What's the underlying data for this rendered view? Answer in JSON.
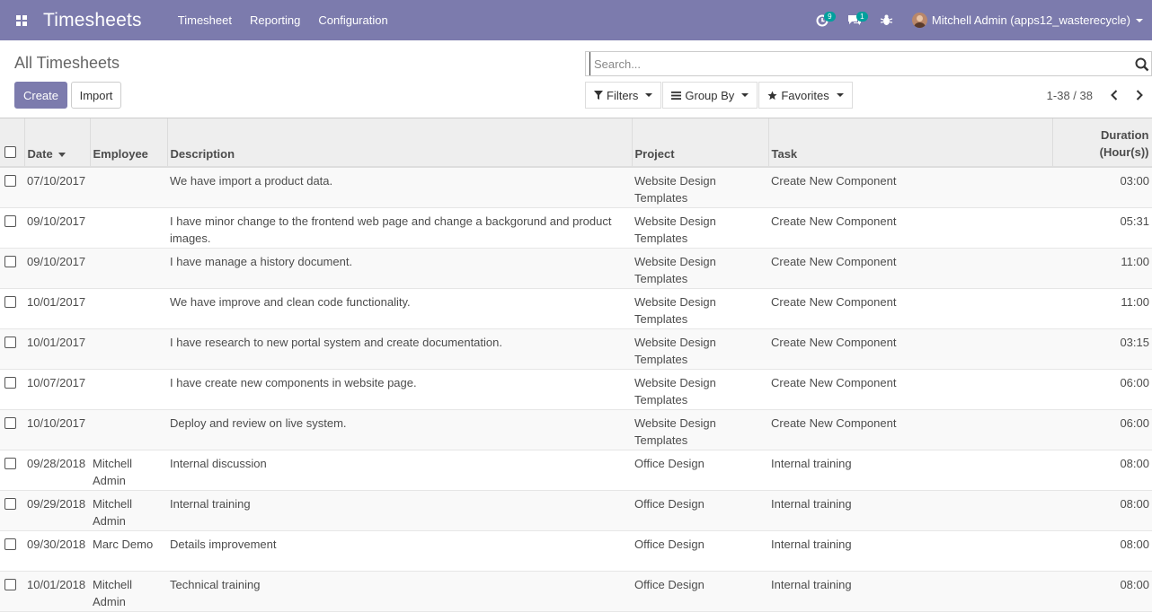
{
  "navbar": {
    "app_title": "Timesheets",
    "menu": [
      {
        "label": "Timesheet"
      },
      {
        "label": "Reporting"
      },
      {
        "label": "Configuration"
      }
    ],
    "activity_count": "9",
    "messages_count": "1",
    "user_name": "Mitchell Admin (apps12_wasterecycle)",
    "bg_color": "#7c7bad",
    "badge_color": "#00a09d"
  },
  "control_panel": {
    "breadcrumb": "All Timesheets",
    "create_label": "Create",
    "import_label": "Import",
    "search_placeholder": "Search...",
    "filters_label": "Filters",
    "groupby_label": "Group By",
    "favorites_label": "Favorites",
    "pager_value": "1-38 / 38"
  },
  "table": {
    "columns": {
      "date": "Date",
      "employee": "Employee",
      "description": "Description",
      "project": "Project",
      "task": "Task",
      "duration_1": "Duration",
      "duration_2": "(Hour(s))"
    },
    "rows": [
      {
        "date": "07/10/2017",
        "employee": "",
        "description": "We have import a product data.",
        "project": "Website Design Templates",
        "task": "Create New Component",
        "duration": "03:00"
      },
      {
        "date": "09/10/2017",
        "employee": "",
        "description": "I have minor change to the frontend web page and change a backgorund and product images.",
        "project": "Website Design Templates",
        "task": "Create New Component",
        "duration": "05:31"
      },
      {
        "date": "09/10/2017",
        "employee": "",
        "description": "I have manage a history document.",
        "project": "Website Design Templates",
        "task": "Create New Component",
        "duration": "11:00"
      },
      {
        "date": "10/01/2017",
        "employee": "",
        "description": "We have improve and clean code functionality.",
        "project": "Website Design Templates",
        "task": "Create New Component",
        "duration": "11:00"
      },
      {
        "date": "10/01/2017",
        "employee": "",
        "description": "I have research to new portal system and create documentation.",
        "project": "Website Design Templates",
        "task": "Create New Component",
        "duration": "03:15"
      },
      {
        "date": "10/07/2017",
        "employee": "",
        "description": "I have create new components in website page.",
        "project": "Website Design Templates",
        "task": "Create New Component",
        "duration": "06:00"
      },
      {
        "date": "10/10/2017",
        "employee": "",
        "description": "Deploy and review on live system.",
        "project": "Website Design Templates",
        "task": "Create New Component",
        "duration": "06:00"
      },
      {
        "date": "09/28/2018",
        "employee": "Mitchell Admin",
        "description": "Internal discussion",
        "project": "Office Design",
        "task": "Internal training",
        "duration": "08:00"
      },
      {
        "date": "09/29/2018",
        "employee": "Mitchell Admin",
        "description": "Internal training",
        "project": "Office Design",
        "task": "Internal training",
        "duration": "08:00"
      },
      {
        "date": "09/30/2018",
        "employee": "Marc Demo",
        "description": "Details improvement",
        "project": "Office Design",
        "task": "Internal training",
        "duration": "08:00"
      },
      {
        "date": "10/01/2018",
        "employee": "Mitchell Admin",
        "description": "Technical training",
        "project": "Office Design",
        "task": "Internal training",
        "duration": "08:00"
      }
    ]
  }
}
